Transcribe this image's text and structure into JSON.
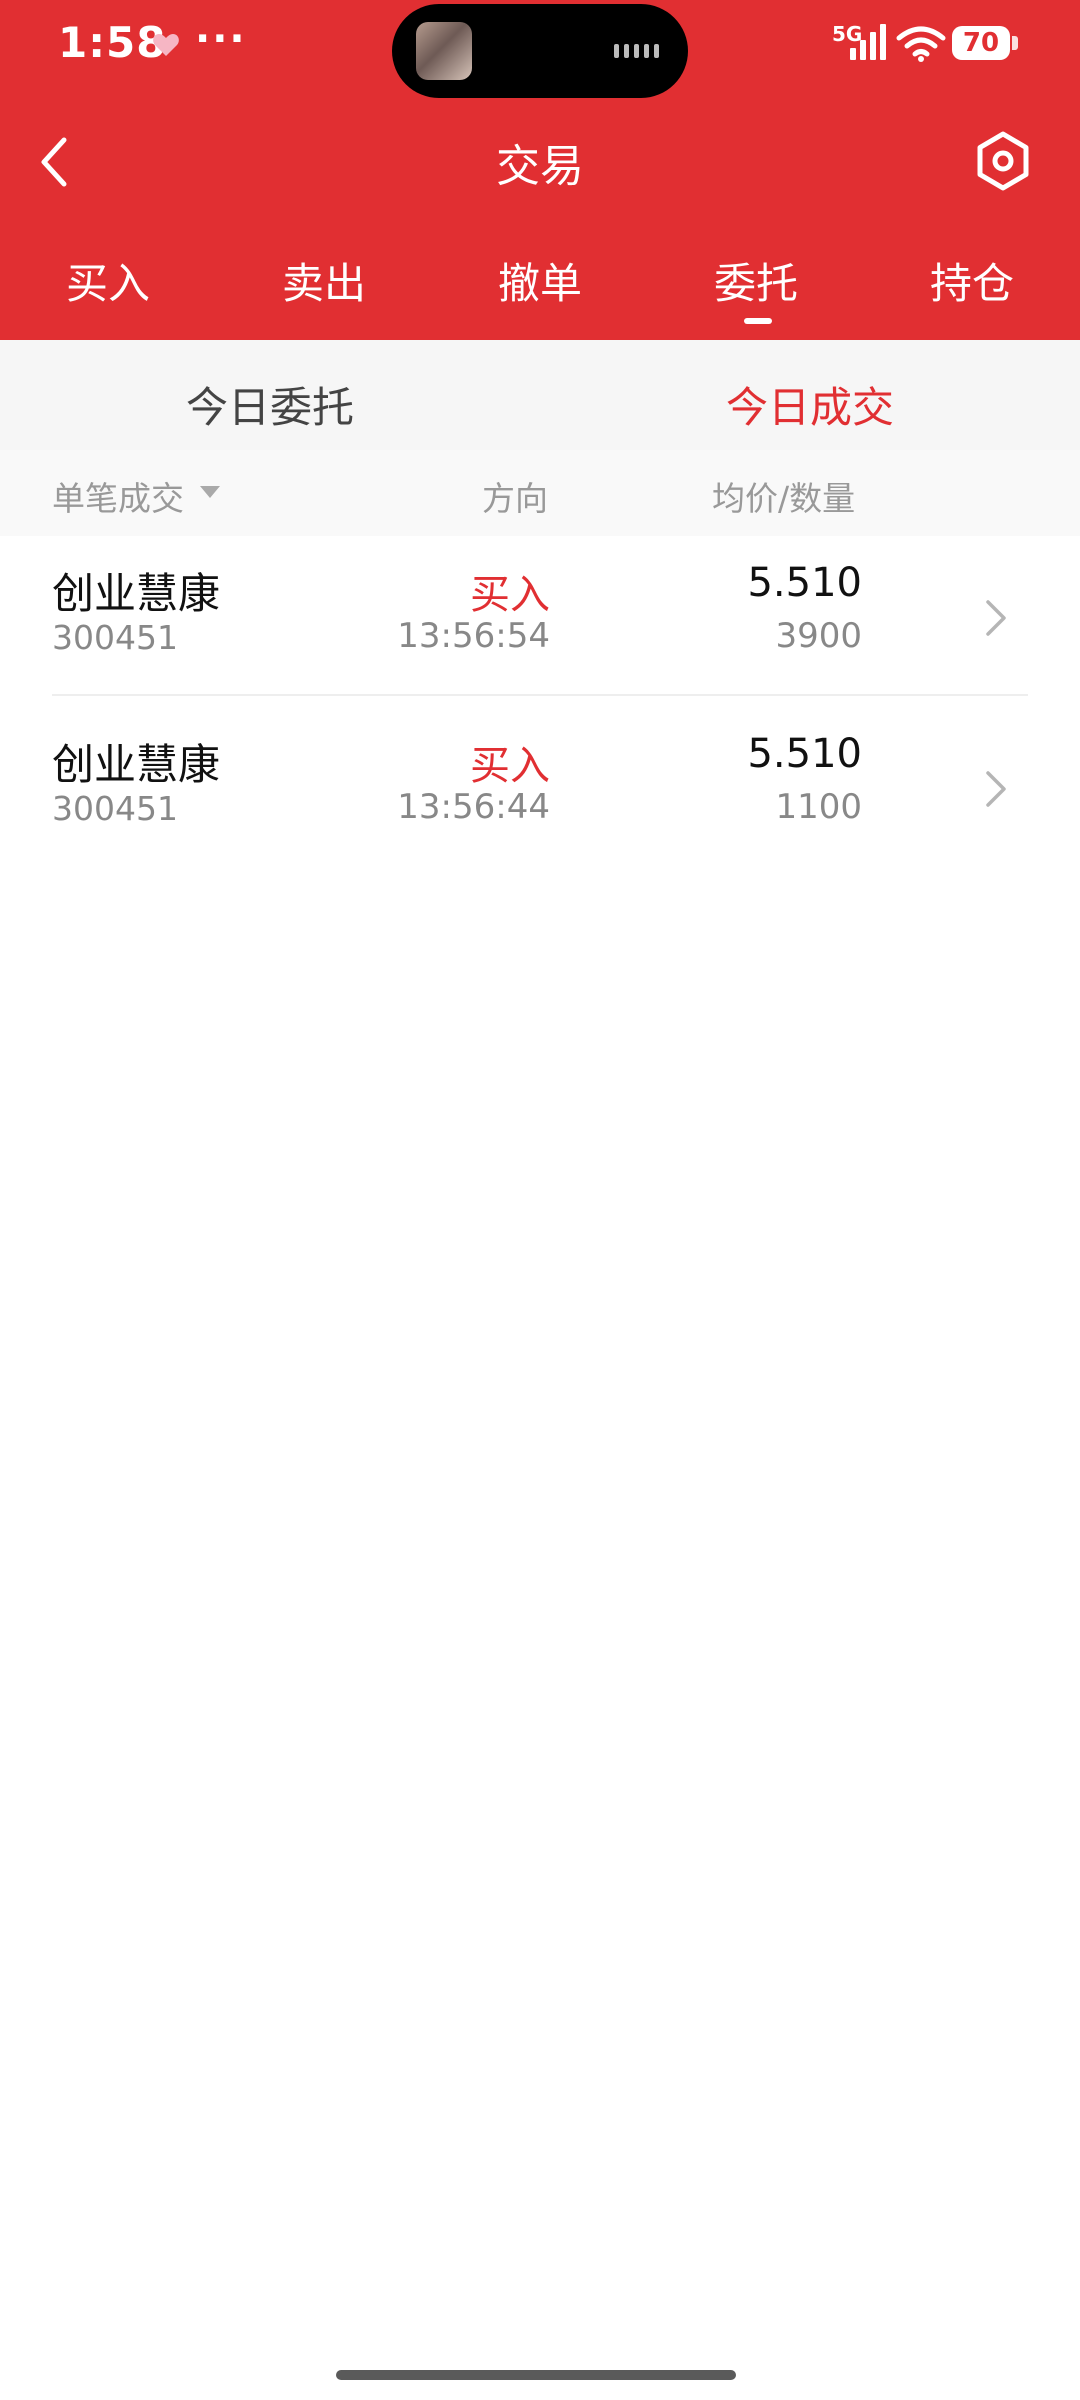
{
  "status_bar": {
    "time": "1:58",
    "dots": "···",
    "network_label": "5G",
    "battery": "70"
  },
  "header": {
    "title": "交易"
  },
  "tabs": [
    {
      "label": "买入"
    },
    {
      "label": "卖出"
    },
    {
      "label": "撤单"
    },
    {
      "label": "委托",
      "active": true
    },
    {
      "label": "持仓"
    }
  ],
  "sub_tabs": [
    {
      "label": "今日委托",
      "active": false
    },
    {
      "label": "今日成交",
      "active": true
    }
  ],
  "columns": {
    "col1": "单笔成交",
    "col2": "方向",
    "col3": "均价/数量"
  },
  "rows": [
    {
      "name": "创业慧康",
      "code": "300451",
      "direction": "买入",
      "time": "13:56:54",
      "price": "5.510",
      "quantity": "3900"
    },
    {
      "name": "创业慧康",
      "code": "300451",
      "direction": "买入",
      "time": "13:56:44",
      "price": "5.510",
      "quantity": "1100"
    }
  ],
  "colors": {
    "accent": "#e12f32",
    "header_bg": "#e12f32",
    "subtab_bg": "#f6f6f6"
  }
}
